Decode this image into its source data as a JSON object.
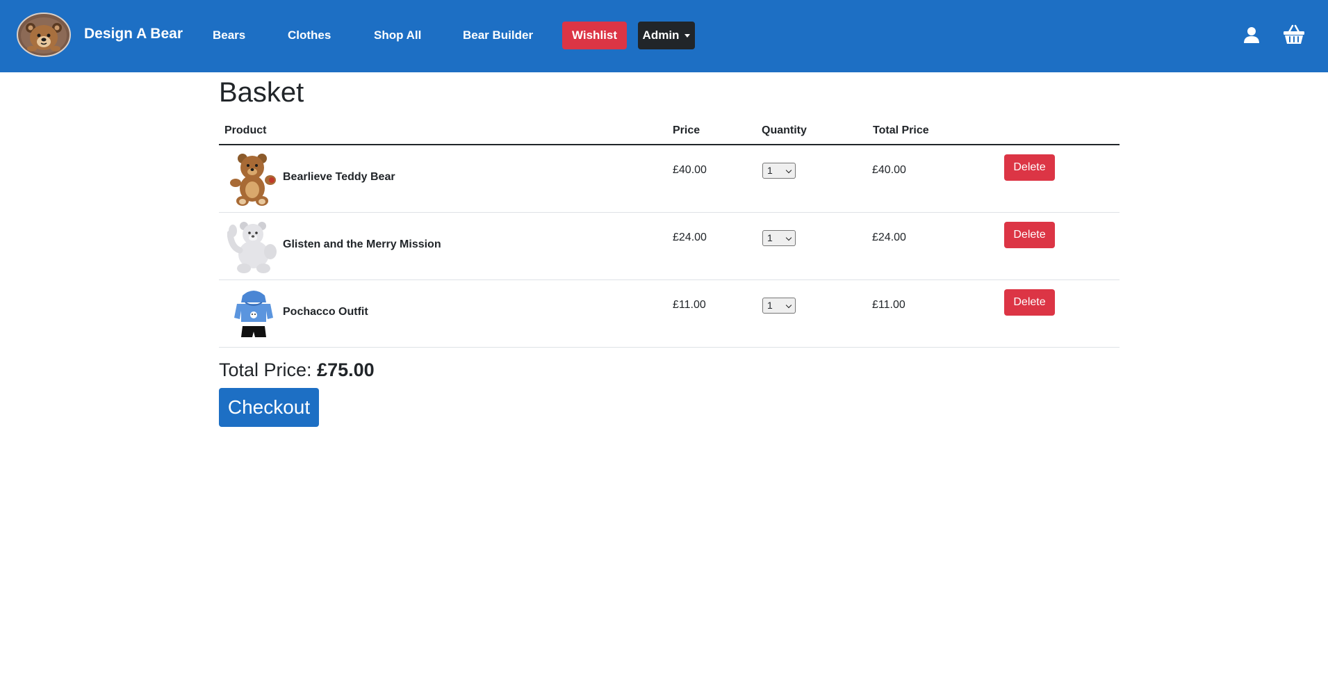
{
  "header": {
    "brand": "Design A Bear",
    "nav_links": [
      "Bears",
      "Clothes",
      "Shop All",
      "Bear Builder"
    ],
    "wishlist_label": "Wishlist",
    "admin_label": "Admin",
    "icons": [
      "bear-logo-icon",
      "user-icon",
      "basket-icon",
      "chevron-down-icon"
    ]
  },
  "basket": {
    "title": "Basket",
    "columns": [
      "Product",
      "Price",
      "Quantity",
      "Total Price"
    ],
    "items": [
      {
        "name": "Bearlieve Teddy Bear",
        "price": "£40.00",
        "quantity": "1",
        "total": "£40.00",
        "delete_label": "Delete",
        "image": "brown-teddy-bear"
      },
      {
        "name": "Glisten and the Merry Mission",
        "price": "£24.00",
        "quantity": "1",
        "total": "£24.00",
        "delete_label": "Delete",
        "image": "white-glitter-bear"
      },
      {
        "name": "Pochacco Outfit",
        "price": "£11.00",
        "quantity": "1",
        "total": "£11.00",
        "delete_label": "Delete",
        "image": "blue-hoodie-outfit"
      }
    ],
    "total_label": "Total Price:",
    "total_value": "£75.00",
    "checkout_label": "Checkout"
  },
  "colors": {
    "navbar": "#1d6fc4",
    "danger": "#dc3545",
    "dark": "#212529",
    "primary": "#1d6fc4"
  }
}
